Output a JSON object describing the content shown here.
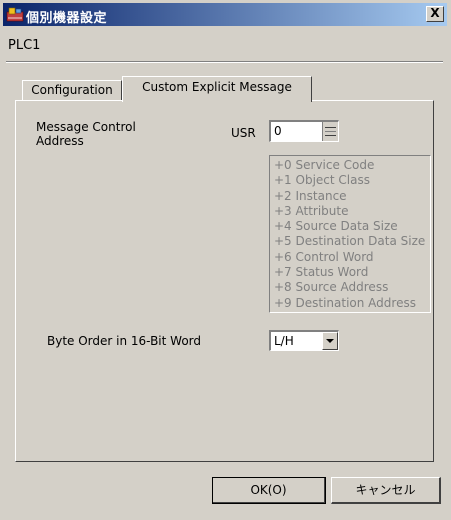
{
  "window": {
    "title": "個別機器設定",
    "close_label": "X",
    "icon": "settings-app-icon"
  },
  "device_name": "PLC1",
  "tabs": [
    {
      "label": "Configuration",
      "active": false
    },
    {
      "label": "Custom Explicit Message",
      "active": true
    }
  ],
  "message_control": {
    "label_line1": "Message Control",
    "label_line2": "Address",
    "device_type": "USR",
    "address_value": "0"
  },
  "offset_list": [
    "+0 Service Code",
    "+1 Object Class",
    "+2 Instance",
    "+3 Attribute",
    "+4 Source Data Size",
    "+5 Destination Data Size",
    "+6 Control Word",
    "+7 Status Word",
    "+8 Source Address",
    "+9 Destination Address"
  ],
  "byte_order": {
    "label": "Byte Order in 16-Bit Word",
    "value": "L/H"
  },
  "buttons": {
    "ok": "OK(O)",
    "cancel": "キャンセル"
  },
  "colors": {
    "face": "#d4d0c8",
    "title_start": "#0a246a",
    "title_end": "#a6caf0",
    "disabled_text": "#808080"
  }
}
